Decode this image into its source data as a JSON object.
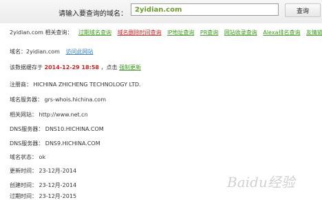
{
  "search": {
    "label": "请输入要查询的域名：",
    "value": "2yidian.com",
    "button": "查询"
  },
  "related": {
    "prefix": "2yidian.com 相关查询：",
    "links": [
      {
        "label": "过期域名查询",
        "color": "#3a9a1a"
      },
      {
        "label": "域名删除时间查询",
        "color": "#cc2222"
      },
      {
        "label": "IP地址查询",
        "color": "#3a9a1a"
      },
      {
        "label": "PR查询",
        "color": "#3a9a1a"
      },
      {
        "label": "网站收录查询",
        "color": "#3a9a1a"
      },
      {
        "label": "Alexa排名查询",
        "color": "#3a9a1a"
      },
      {
        "label": "友情链接检测",
        "color": "#3a9a1a"
      }
    ]
  },
  "domain_line": {
    "label": "域名：2yidian.com",
    "visit_link": "访问此网站"
  },
  "cache_line": {
    "prefix": "该数据缓存于",
    "date": "2014-12-29 18:58",
    "middle": "，点击",
    "refresh_link": "强制更新"
  },
  "fields": [
    {
      "label": "注册商：",
      "value": "HICHINA ZHICHENG TECHNOLOGY LTD."
    },
    {
      "label": "域名服务器：",
      "value": "grs-whois.hichina.com"
    },
    {
      "label": "相关网站：",
      "value": "http://www.net.cn"
    },
    {
      "label": "DNS服务器：",
      "value": "DNS10.HICHINA.COM"
    },
    {
      "label": "DNS服务器：",
      "value": "DNS9.HICHINA.COM"
    },
    {
      "label": "域名状态：",
      "value": "ok"
    },
    {
      "label": "更新时间：",
      "value": "23-12月-2014"
    },
    {
      "label": "创建时间：",
      "value": "23-12月-2014"
    },
    {
      "label": "过期时间：",
      "value": "23-12月-2015"
    }
  ],
  "watermark": "Baidu经验"
}
